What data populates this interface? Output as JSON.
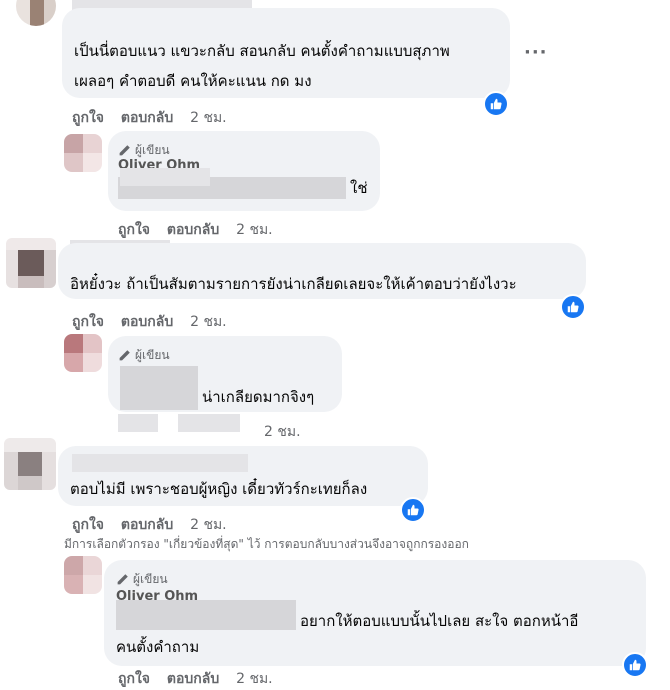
{
  "comments": [
    {
      "text_lines": [
        "เป็นนี่ตอบแนว แขวะกลับ สอนกลับ คนตั้งคำถามแบบสุภาพ",
        "เผลอๆ คำตอบดี คนให้คะแนน กด มง"
      ],
      "actions": {
        "like": "ถูกใจ",
        "reply": "ตอบกลับ",
        "time": "2 ชม."
      },
      "more": "···"
    },
    {
      "author_badge": "ผู้เขียน",
      "author_name": "Oliver Ohm",
      "text_tail": "ใช่",
      "actions": {
        "like": "ถูกใจ",
        "reply": "ตอบกลับ",
        "time": "2 ชม."
      }
    },
    {
      "text_lines": [
        "อิหยั๋งวะ ถ้าเป็นสัมตามรายการยังน่าเกลียดเลยจะให้เค้าตอบว่ายังไงวะ"
      ],
      "actions": {
        "like": "ถูกใจ",
        "reply": "ตอบกลับ",
        "time": "2 ชม."
      }
    },
    {
      "author_badge": "ผู้เขียน",
      "text_tail": "น่าเกลียดมากจิงๆ",
      "actions": {
        "time": "2 ชม."
      }
    },
    {
      "text_lines": [
        "ตอบไม่มี เพราะชอบผู้หญิง เดี๋ยวทัวร์กะเทยก็ลง"
      ],
      "actions": {
        "like": "ถูกใจ",
        "reply": "ตอบกลับ",
        "time": "2 ชม."
      }
    },
    {
      "author_badge": "ผู้เขียน",
      "author_name": "Oliver Ohm",
      "text_lines": [
        "อยากให้ตอบแบบนั้นไปเลย สะใจ ตอกหน้าอี",
        "คนตั้งคำถาม"
      ],
      "actions": {
        "like": "ถูกใจ",
        "reply": "ตอบกลับ",
        "time": "2 ชม."
      }
    }
  ],
  "filter_note": "มีการเลือกตัวกรอง \"เกี่ยวข้องที่สุด\" ไว้ การตอบกลับบางส่วนจึงอาจถูกกรองออก",
  "icons": {
    "like": "thumbs-up-icon",
    "pencil": "pencil-icon",
    "more": "more-horizontal-icon"
  },
  "colors": {
    "bubble": "#f0f2f5",
    "meta": "#65676b",
    "like_blue": "#1877f2"
  }
}
